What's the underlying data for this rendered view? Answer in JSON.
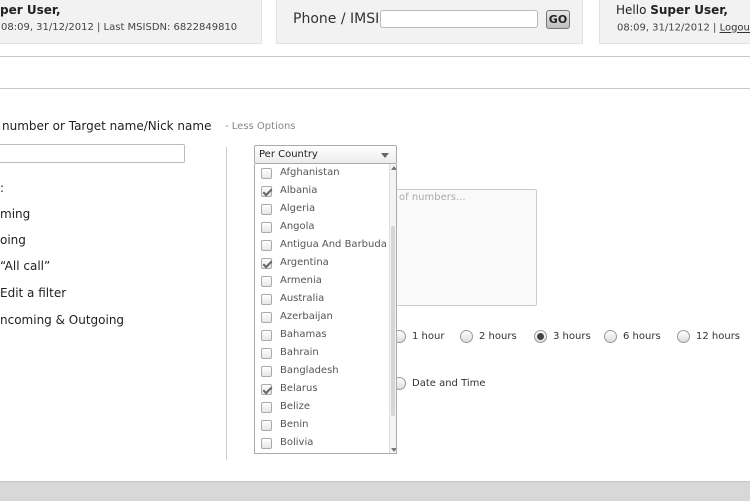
{
  "header": {
    "left_greeting": "per User,",
    "left_meta": "08:09, 31/12/2012  |  Last MSISDN: 6822849810",
    "phone_label": "Phone / IMSI",
    "phone_value": "",
    "go_label": "GO",
    "right_greeting_prefix": "Hello ",
    "right_greeting_name": "Super User,",
    "right_meta": "08:09, 31/12/2012  |",
    "logout_label": "Logout",
    "logout_icon": "power-icon"
  },
  "form": {
    "search_label": "number or Target name/Nick name",
    "less_options": "- Less Options",
    "search_value": "",
    "options_label": ":",
    "option_incoming": "ming",
    "option_outgoing": "oing",
    "option_all_call": "“All call”",
    "option_edit_filter": " Edit a filter",
    "option_in_out": "ncoming & Outgoing",
    "numbers_placeholder": "of numbers..."
  },
  "country_select": {
    "selected": "Per Country",
    "options": [
      {
        "label": "Afghanistan",
        "checked": false
      },
      {
        "label": "Albania",
        "checked": true
      },
      {
        "label": "Algeria",
        "checked": false
      },
      {
        "label": "Angola",
        "checked": false
      },
      {
        "label": "Antigua And Barbuda",
        "checked": false
      },
      {
        "label": "Argentina",
        "checked": true
      },
      {
        "label": "Armenia",
        "checked": false
      },
      {
        "label": "Australia",
        "checked": false
      },
      {
        "label": "Azerbaijan",
        "checked": false
      },
      {
        "label": "Bahamas",
        "checked": false
      },
      {
        "label": "Bahrain",
        "checked": false
      },
      {
        "label": "Bangladesh",
        "checked": false
      },
      {
        "label": "Belarus",
        "checked": true
      },
      {
        "label": "Belize",
        "checked": false
      },
      {
        "label": "Benin",
        "checked": false
      },
      {
        "label": "Bolivia",
        "checked": false
      }
    ]
  },
  "time_range": {
    "options": [
      {
        "label": "1 hour",
        "selected": false
      },
      {
        "label": "2 hours",
        "selected": false
      },
      {
        "label": "3 hours",
        "selected": true
      },
      {
        "label": "6 hours",
        "selected": false
      },
      {
        "label": "12 hours",
        "selected": false
      }
    ],
    "date_time_label": "Date and Time"
  }
}
